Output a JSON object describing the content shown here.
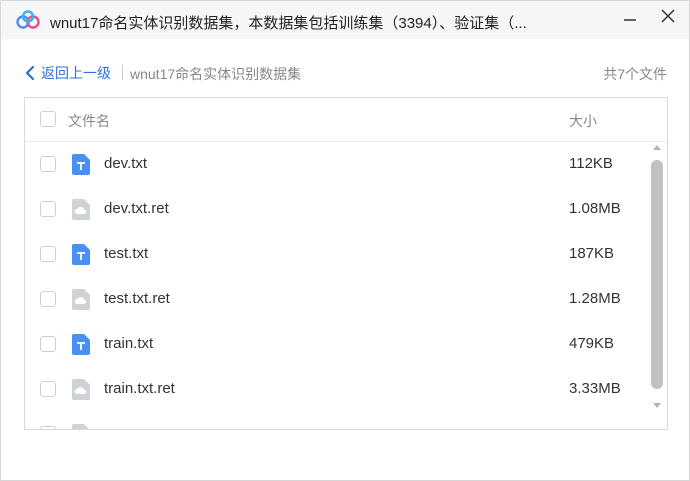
{
  "window": {
    "title": "wnut17命名实体识别数据集，本数据集包括训练集（3394）、验证集（..."
  },
  "nav": {
    "back_label": "返回上一级",
    "folder_name": "wnut17命名实体识别数据集",
    "file_count": "共7个文件"
  },
  "list": {
    "header_name": "文件名",
    "header_size": "大小",
    "files": [
      {
        "name": "dev.txt",
        "size": "112KB",
        "icon": "txt-file-icon"
      },
      {
        "name": "dev.txt.ret",
        "size": "1.08MB",
        "icon": "generic-file-icon"
      },
      {
        "name": "test.txt",
        "size": "187KB",
        "icon": "txt-file-icon"
      },
      {
        "name": "test.txt.ret",
        "size": "1.28MB",
        "icon": "generic-file-icon"
      },
      {
        "name": "train.txt",
        "size": "479KB",
        "icon": "txt-file-icon"
      },
      {
        "name": "train.txt.ret",
        "size": "3.33MB",
        "icon": "generic-file-icon"
      },
      {
        "name": "",
        "size": "",
        "icon": "generic-file-icon"
      }
    ]
  },
  "colors": {
    "accent": "#2d6fd9",
    "txt_icon": "#4a8ff2",
    "generic_icon": "#cfd3d8"
  }
}
